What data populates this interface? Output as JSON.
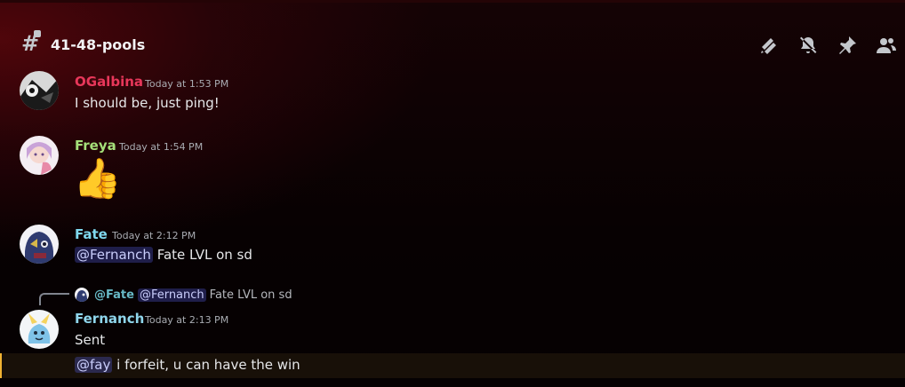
{
  "channel": {
    "name": "41-48-pools"
  },
  "header_icons": [
    "threads-icon",
    "notifications-muted-icon",
    "pin-icon",
    "member-list-icon"
  ],
  "messages": [
    {
      "author": "OGalbina",
      "author_color": "#e8375a",
      "timestamp": "Today at 1:53 PM",
      "text": "I should be, just ping!"
    },
    {
      "author": "Freya",
      "author_color": "#a5e07a",
      "timestamp": "Today at 1:54 PM",
      "emoji": "👍"
    },
    {
      "author": "Fate",
      "author_color": "#7fd8ee",
      "timestamp": "Today at 2:12 PM",
      "mention": "@Fernanch",
      "text": "Fate LVL on sd"
    },
    {
      "author": "Fernanch",
      "author_color": "#8fd6ec",
      "timestamp": "Today at 2:13 PM",
      "text": "Sent",
      "reply": {
        "author": "@Fate",
        "mention": "@Fernanch",
        "text": "Fate LVL on sd"
      },
      "followup": {
        "mention": "@fay",
        "text": "i forfeit, u can have the win"
      }
    }
  ]
}
